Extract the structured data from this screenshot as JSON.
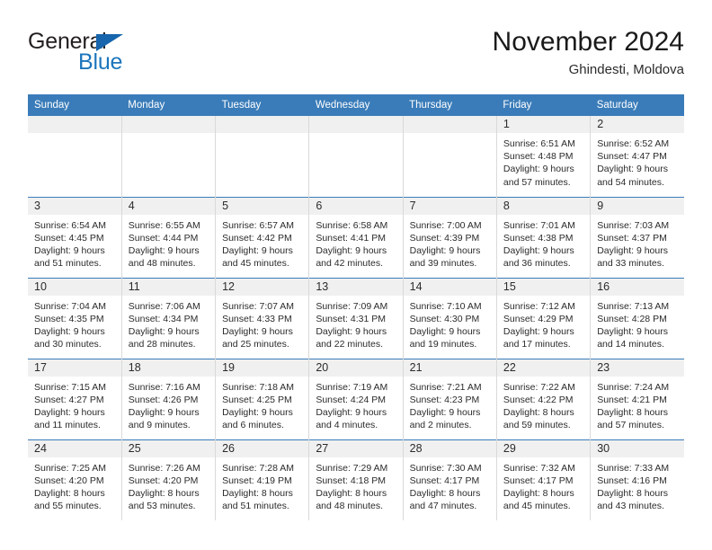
{
  "logo": {
    "line1": "General",
    "line2": "Blue",
    "triangle_color": "#1665ad",
    "text_color": "#231f20",
    "blue_color": "#1c75bc"
  },
  "header": {
    "title": "November 2024",
    "subtitle": "Ghindesti, Moldova"
  },
  "theme": {
    "header_blue": "#3a7cb9",
    "daynum_band": "#f0f0f0",
    "grid_line": "#d9d9d9"
  },
  "calendar": {
    "weekday_headers": [
      "Sunday",
      "Monday",
      "Tuesday",
      "Wednesday",
      "Thursday",
      "Friday",
      "Saturday"
    ],
    "weeks": [
      [
        {
          "day": "",
          "lines": []
        },
        {
          "day": "",
          "lines": []
        },
        {
          "day": "",
          "lines": []
        },
        {
          "day": "",
          "lines": []
        },
        {
          "day": "",
          "lines": []
        },
        {
          "day": "1",
          "lines": [
            "Sunrise: 6:51 AM",
            "Sunset: 4:48 PM",
            "Daylight: 9 hours",
            "and 57 minutes."
          ]
        },
        {
          "day": "2",
          "lines": [
            "Sunrise: 6:52 AM",
            "Sunset: 4:47 PM",
            "Daylight: 9 hours",
            "and 54 minutes."
          ]
        }
      ],
      [
        {
          "day": "3",
          "lines": [
            "Sunrise: 6:54 AM",
            "Sunset: 4:45 PM",
            "Daylight: 9 hours",
            "and 51 minutes."
          ]
        },
        {
          "day": "4",
          "lines": [
            "Sunrise: 6:55 AM",
            "Sunset: 4:44 PM",
            "Daylight: 9 hours",
            "and 48 minutes."
          ]
        },
        {
          "day": "5",
          "lines": [
            "Sunrise: 6:57 AM",
            "Sunset: 4:42 PM",
            "Daylight: 9 hours",
            "and 45 minutes."
          ]
        },
        {
          "day": "6",
          "lines": [
            "Sunrise: 6:58 AM",
            "Sunset: 4:41 PM",
            "Daylight: 9 hours",
            "and 42 minutes."
          ]
        },
        {
          "day": "7",
          "lines": [
            "Sunrise: 7:00 AM",
            "Sunset: 4:39 PM",
            "Daylight: 9 hours",
            "and 39 minutes."
          ]
        },
        {
          "day": "8",
          "lines": [
            "Sunrise: 7:01 AM",
            "Sunset: 4:38 PM",
            "Daylight: 9 hours",
            "and 36 minutes."
          ]
        },
        {
          "day": "9",
          "lines": [
            "Sunrise: 7:03 AM",
            "Sunset: 4:37 PM",
            "Daylight: 9 hours",
            "and 33 minutes."
          ]
        }
      ],
      [
        {
          "day": "10",
          "lines": [
            "Sunrise: 7:04 AM",
            "Sunset: 4:35 PM",
            "Daylight: 9 hours",
            "and 30 minutes."
          ]
        },
        {
          "day": "11",
          "lines": [
            "Sunrise: 7:06 AM",
            "Sunset: 4:34 PM",
            "Daylight: 9 hours",
            "and 28 minutes."
          ]
        },
        {
          "day": "12",
          "lines": [
            "Sunrise: 7:07 AM",
            "Sunset: 4:33 PM",
            "Daylight: 9 hours",
            "and 25 minutes."
          ]
        },
        {
          "day": "13",
          "lines": [
            "Sunrise: 7:09 AM",
            "Sunset: 4:31 PM",
            "Daylight: 9 hours",
            "and 22 minutes."
          ]
        },
        {
          "day": "14",
          "lines": [
            "Sunrise: 7:10 AM",
            "Sunset: 4:30 PM",
            "Daylight: 9 hours",
            "and 19 minutes."
          ]
        },
        {
          "day": "15",
          "lines": [
            "Sunrise: 7:12 AM",
            "Sunset: 4:29 PM",
            "Daylight: 9 hours",
            "and 17 minutes."
          ]
        },
        {
          "day": "16",
          "lines": [
            "Sunrise: 7:13 AM",
            "Sunset: 4:28 PM",
            "Daylight: 9 hours",
            "and 14 minutes."
          ]
        }
      ],
      [
        {
          "day": "17",
          "lines": [
            "Sunrise: 7:15 AM",
            "Sunset: 4:27 PM",
            "Daylight: 9 hours",
            "and 11 minutes."
          ]
        },
        {
          "day": "18",
          "lines": [
            "Sunrise: 7:16 AM",
            "Sunset: 4:26 PM",
            "Daylight: 9 hours",
            "and 9 minutes."
          ]
        },
        {
          "day": "19",
          "lines": [
            "Sunrise: 7:18 AM",
            "Sunset: 4:25 PM",
            "Daylight: 9 hours",
            "and 6 minutes."
          ]
        },
        {
          "day": "20",
          "lines": [
            "Sunrise: 7:19 AM",
            "Sunset: 4:24 PM",
            "Daylight: 9 hours",
            "and 4 minutes."
          ]
        },
        {
          "day": "21",
          "lines": [
            "Sunrise: 7:21 AM",
            "Sunset: 4:23 PM",
            "Daylight: 9 hours",
            "and 2 minutes."
          ]
        },
        {
          "day": "22",
          "lines": [
            "Sunrise: 7:22 AM",
            "Sunset: 4:22 PM",
            "Daylight: 8 hours",
            "and 59 minutes."
          ]
        },
        {
          "day": "23",
          "lines": [
            "Sunrise: 7:24 AM",
            "Sunset: 4:21 PM",
            "Daylight: 8 hours",
            "and 57 minutes."
          ]
        }
      ],
      [
        {
          "day": "24",
          "lines": [
            "Sunrise: 7:25 AM",
            "Sunset: 4:20 PM",
            "Daylight: 8 hours",
            "and 55 minutes."
          ]
        },
        {
          "day": "25",
          "lines": [
            "Sunrise: 7:26 AM",
            "Sunset: 4:20 PM",
            "Daylight: 8 hours",
            "and 53 minutes."
          ]
        },
        {
          "day": "26",
          "lines": [
            "Sunrise: 7:28 AM",
            "Sunset: 4:19 PM",
            "Daylight: 8 hours",
            "and 51 minutes."
          ]
        },
        {
          "day": "27",
          "lines": [
            "Sunrise: 7:29 AM",
            "Sunset: 4:18 PM",
            "Daylight: 8 hours",
            "and 48 minutes."
          ]
        },
        {
          "day": "28",
          "lines": [
            "Sunrise: 7:30 AM",
            "Sunset: 4:17 PM",
            "Daylight: 8 hours",
            "and 47 minutes."
          ]
        },
        {
          "day": "29",
          "lines": [
            "Sunrise: 7:32 AM",
            "Sunset: 4:17 PM",
            "Daylight: 8 hours",
            "and 45 minutes."
          ]
        },
        {
          "day": "30",
          "lines": [
            "Sunrise: 7:33 AM",
            "Sunset: 4:16 PM",
            "Daylight: 8 hours",
            "and 43 minutes."
          ]
        }
      ]
    ]
  }
}
